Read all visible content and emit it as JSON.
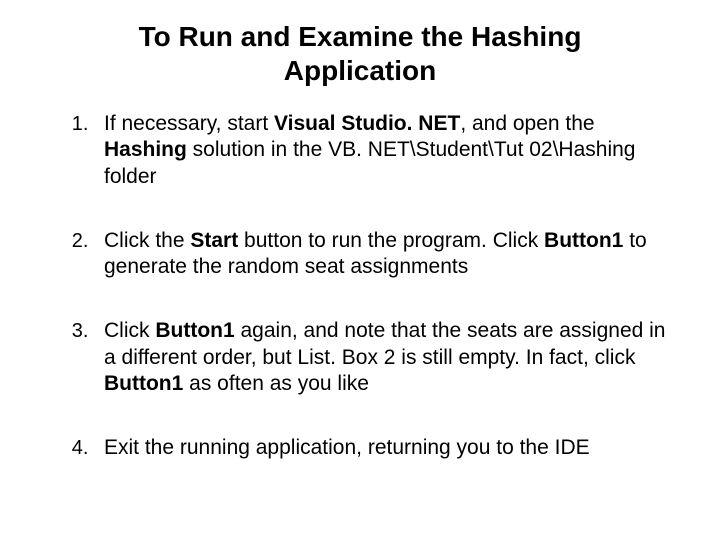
{
  "title": "To Run and Examine the Hashing Application",
  "steps": [
    {
      "pre1": "If necessary, start ",
      "bold1": "Visual Studio. NET",
      "mid1": ", and open the ",
      "bold2": "Hashing",
      "mid2": " solution in the VB. NET\\Student\\Tut 02\\Hashing folder",
      "bold3": "",
      "mid3": "",
      "bold4": "",
      "tail": ""
    },
    {
      "pre1": "Click the ",
      "bold1": "Start",
      "mid1": " button to run the program. Click ",
      "bold2": "Button1",
      "mid2": " to generate the random seat assignments",
      "bold3": "",
      "mid3": "",
      "bold4": "",
      "tail": ""
    },
    {
      "pre1": "Click ",
      "bold1": "Button1",
      "mid1": " again, and note that the seats are assigned in a different order, but List. Box 2 is still empty. In fact, click ",
      "bold2": "Button1",
      "mid2": " as often as you like",
      "bold3": "",
      "mid3": "",
      "bold4": "",
      "tail": ""
    },
    {
      "pre1": "Exit the running application, returning you to the IDE",
      "bold1": "",
      "mid1": "",
      "bold2": "",
      "mid2": "",
      "bold3": "",
      "mid3": "",
      "bold4": "",
      "tail": ""
    }
  ]
}
